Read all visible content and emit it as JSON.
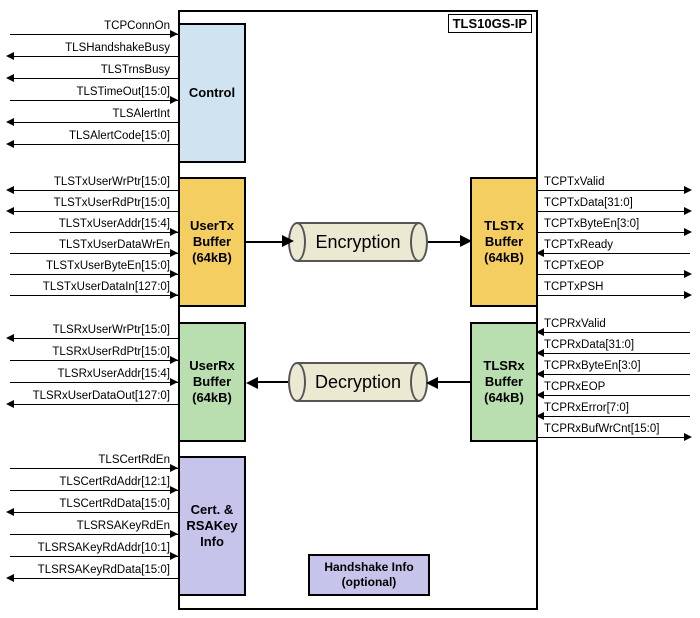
{
  "diagram": {
    "title": "TLS10GS-IP",
    "blocks": {
      "control": "Control",
      "usertx": "UserTx\nBuffer\n(64kB)",
      "tlstx": "TLSTx\nBuffer\n(64kB)",
      "userrx": "UserRx\nBuffer\n(64kB)",
      "tlsrx": "TLSRx\nBuffer\n(64kB)",
      "cert": "Cert. &\nRSAKey\nInfo",
      "hsinfo": "Handshake Info\n(optional)"
    },
    "processes": {
      "encryption": "Encryption",
      "decryption": "Decryption"
    },
    "signals": {
      "control": [
        {
          "name": "TCPConnOn",
          "dir": "in"
        },
        {
          "name": "TLSHandshakeBusy",
          "dir": "out"
        },
        {
          "name": "TLSTrnsBusy",
          "dir": "out"
        },
        {
          "name": "TLSTimeOut[15:0]",
          "dir": "in"
        },
        {
          "name": "TLSAlertInt",
          "dir": "out"
        },
        {
          "name": "TLSAlertCode[15:0]",
          "dir": "out"
        }
      ],
      "usertx": [
        {
          "name": "TLSTxUserWrPtr[15:0]",
          "dir": "out"
        },
        {
          "name": "TLSTxUserRdPtr[15:0]",
          "dir": "out"
        },
        {
          "name": "TLSTxUserAddr[15:4]",
          "dir": "in"
        },
        {
          "name": "TLSTxUserDataWrEn",
          "dir": "in"
        },
        {
          "name": "TLSTxUserByteEn[15:0]",
          "dir": "in"
        },
        {
          "name": "TLSTxUserDataIn[127:0]",
          "dir": "in"
        }
      ],
      "userrx": [
        {
          "name": "TLSRxUserWrPtr[15:0]",
          "dir": "out"
        },
        {
          "name": "TLSRxUserRdPtr[15:0]",
          "dir": "in"
        },
        {
          "name": "TLSRxUserAddr[15:4]",
          "dir": "in"
        },
        {
          "name": "TLSRxUserDataOut[127:0]",
          "dir": "out"
        }
      ],
      "cert": [
        {
          "name": "TLSCertRdEn",
          "dir": "in"
        },
        {
          "name": "TLSCertRdAddr[12:1]",
          "dir": "in"
        },
        {
          "name": "TLSCertRdData[15:0]",
          "dir": "out"
        },
        {
          "name": "TLSRSAKeyRdEn",
          "dir": "in"
        },
        {
          "name": "TLSRSAKeyRdAddr[10:1]",
          "dir": "in"
        },
        {
          "name": "TLSRSAKeyRdData[15:0]",
          "dir": "out"
        }
      ],
      "tlstx": [
        {
          "name": "TCPTxValid",
          "dir": "out"
        },
        {
          "name": "TCPTxData[31:0]",
          "dir": "out"
        },
        {
          "name": "TCPTxByteEn[3:0]",
          "dir": "out"
        },
        {
          "name": "TCPTxReady",
          "dir": "in"
        },
        {
          "name": "TCPTxEOP",
          "dir": "out"
        },
        {
          "name": "TCPTxPSH",
          "dir": "out"
        }
      ],
      "tlsrx": [
        {
          "name": "TCPRxValid",
          "dir": "in"
        },
        {
          "name": "TCPRxData[31:0]",
          "dir": "in"
        },
        {
          "name": "TCPRxByteEn[3:0]",
          "dir": "in"
        },
        {
          "name": "TCPRxEOP",
          "dir": "in"
        },
        {
          "name": "TCPRxError[7:0]",
          "dir": "in"
        },
        {
          "name": "TCPRxBufWrCnt[15:0]",
          "dir": "out"
        }
      ]
    }
  }
}
